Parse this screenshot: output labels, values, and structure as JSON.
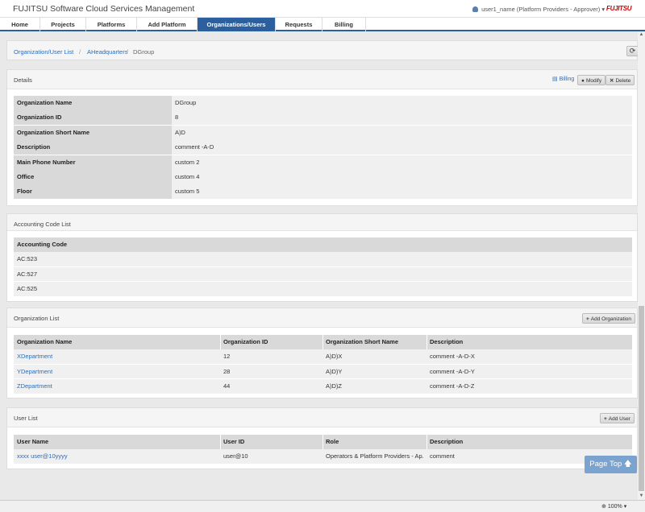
{
  "app": {
    "title": "FUJITSU Software Cloud Services Management",
    "user": "user1_name (Platform Providers - Approver)",
    "user_caret": "▾",
    "logo": "FUJITSU"
  },
  "nav": [
    "Home",
    "Projects",
    "Platforms",
    "Add Platform",
    "Organizations/Users",
    "Requests",
    "Billing"
  ],
  "breadcrumb": {
    "items": [
      "Organization/User List",
      "AHeadquarters",
      "DGroup"
    ],
    "sep": "/"
  },
  "details": {
    "title": "Details",
    "billing_label": "Billing",
    "modify_label": "Modify",
    "delete_label": "Delete",
    "rows": [
      {
        "key": "Organization Name",
        "value": "DGroup"
      },
      {
        "key": "Organization ID",
        "value": "8"
      },
      {
        "key": "Organization Short Name",
        "value": "A)D"
      },
      {
        "key": "Description",
        "value": "comment -A-D"
      },
      {
        "key": "Main Phone Number",
        "value": "custom 2"
      },
      {
        "key": "Office",
        "value": "custom 4"
      },
      {
        "key": "Floor",
        "value": "custom 5"
      }
    ]
  },
  "accounting": {
    "title": "Accounting Code List",
    "header": "Accounting Code",
    "codes": [
      "AC:523",
      "AC:527",
      "AC:525"
    ]
  },
  "orgs": {
    "title": "Organization List",
    "add_label": "Add Organization",
    "headers": [
      "Organization Name",
      "Organization ID",
      "Organization Short Name",
      "Description"
    ],
    "rows": [
      [
        "XDepartment",
        "12",
        "A)D)X",
        "comment -A-D-X"
      ],
      [
        "YDepartment",
        "28",
        "A)D)Y",
        "comment -A-D-Y"
      ],
      [
        "ZDepartment",
        "44",
        "A)D)Z",
        "comment -A-D-Z"
      ]
    ]
  },
  "users": {
    "title": "User List",
    "add_label": "Add User",
    "headers": [
      "User Name",
      "User ID",
      "Role",
      "Description"
    ],
    "rows": [
      [
        "xxxx user@10yyyy",
        "user@10",
        "Operators & Platform Providers - Ap...",
        "comment"
      ]
    ]
  },
  "page_top_label": "Page Top",
  "zoom": "100%",
  "icons": {
    "user": "user-icon",
    "refresh": "refresh-icon",
    "billing": "billing-icon",
    "modify": "modify-icon",
    "delete": "delete-icon",
    "add": "plus-icon",
    "up": "arrow-up-icon"
  },
  "colors": {
    "nav_active": "#2c5f9e",
    "link": "#2a6ebb",
    "logo": "#cc0000",
    "page_top": "#7ba3d0"
  }
}
